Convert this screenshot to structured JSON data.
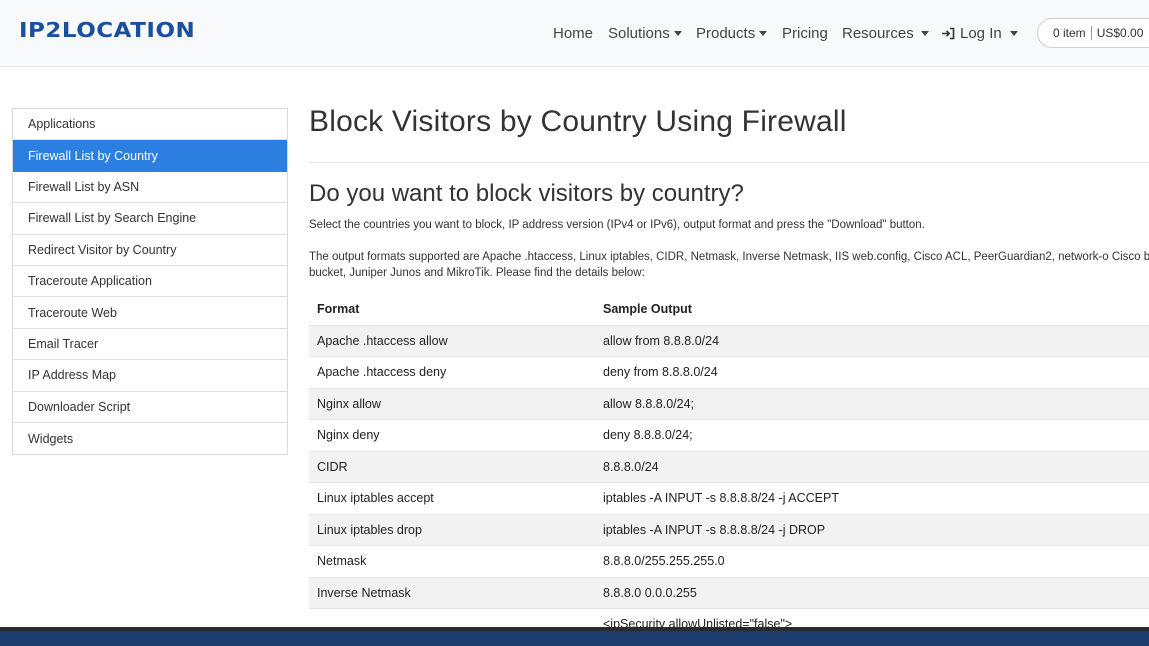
{
  "brand": {
    "logo_text": "IP2LOCATION"
  },
  "nav": {
    "home": "Home",
    "solutions": "Solutions",
    "products": "Products",
    "pricing": "Pricing",
    "resources": "Resources",
    "login": "Log In"
  },
  "cart": {
    "items": "0 item",
    "total": "US$0.00"
  },
  "sidebar": {
    "items": [
      {
        "label": "Applications"
      },
      {
        "label": "Firewall List by Country"
      },
      {
        "label": "Firewall List by ASN"
      },
      {
        "label": "Firewall List by Search Engine"
      },
      {
        "label": "Redirect Visitor by Country"
      },
      {
        "label": "Traceroute Application"
      },
      {
        "label": "Traceroute Web"
      },
      {
        "label": "Email Tracer"
      },
      {
        "label": "IP Address Map"
      },
      {
        "label": "Downloader Script"
      },
      {
        "label": "Widgets"
      }
    ]
  },
  "main": {
    "title": "Block Visitors by Country Using Firewall",
    "subtitle": "Do you want to block visitors by country?",
    "intro": "Select the countries you want to block, IP address version (IPv4 or IPv6), output format and press the \"Download\" button.",
    "formats_text": "The output formats supported are Apache .htaccess, Linux iptables, CIDR, Netmask, Inverse Netmask, IIS web.config, Cisco ACL, PeerGuardian2, network-o Cisco bit bucket, Juniper Junos and MikroTik. Please find the details below:",
    "table": {
      "headers": [
        "Format",
        "Sample Output"
      ],
      "rows": [
        [
          "Apache .htaccess allow",
          "allow from 8.8.8.0/24"
        ],
        [
          "Apache .htaccess deny",
          "deny from 8.8.8.0/24"
        ],
        [
          "Nginx allow",
          "allow 8.8.8.0/24;"
        ],
        [
          "Nginx deny",
          "deny 8.8.8.0/24;"
        ],
        [
          "CIDR",
          "8.8.8.0/24"
        ],
        [
          "Linux iptables accept",
          "iptables -A INPUT -s 8.8.8.8/24 -j ACCEPT"
        ],
        [
          "Linux iptables drop",
          "iptables -A INPUT -s 8.8.8.8/24 -j DROP"
        ],
        [
          "Netmask",
          "8.8.8.0/255.255.255.0"
        ],
        [
          "Inverse Netmask",
          "8.8.8.0 0.0.0.255"
        ],
        [
          "",
          "<ipSecurity allowUnlisted=\"false\">"
        ]
      ]
    }
  },
  "colors": {
    "accent": "#2b7fe0",
    "brand": "#1a4f9c"
  }
}
